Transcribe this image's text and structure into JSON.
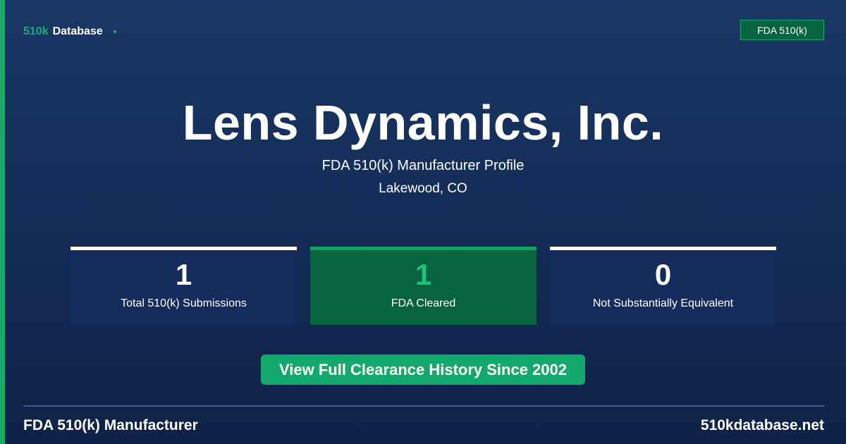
{
  "brand": {
    "prefix": "510k",
    "name": "Database"
  },
  "badge": "FDA 510(k)",
  "company": {
    "name": "Lens Dynamics, Inc.",
    "subtitle": "FDA 510(k) Manufacturer Profile",
    "location": "Lakewood, CO"
  },
  "stats": [
    {
      "value": "1",
      "label": "Total 510(k) Submissions"
    },
    {
      "value": "1",
      "label": "FDA Cleared"
    },
    {
      "value": "0",
      "label": "Not Substantially Equivalent"
    }
  ],
  "cta": "View Full Clearance History Since 2002",
  "footer": {
    "left": "FDA 510(k) Manufacturer",
    "right": "510kdatabase.net"
  },
  "colors": {
    "background": "#1b3766",
    "accent": "#1aa96a",
    "cleared_card": "#07643f"
  }
}
